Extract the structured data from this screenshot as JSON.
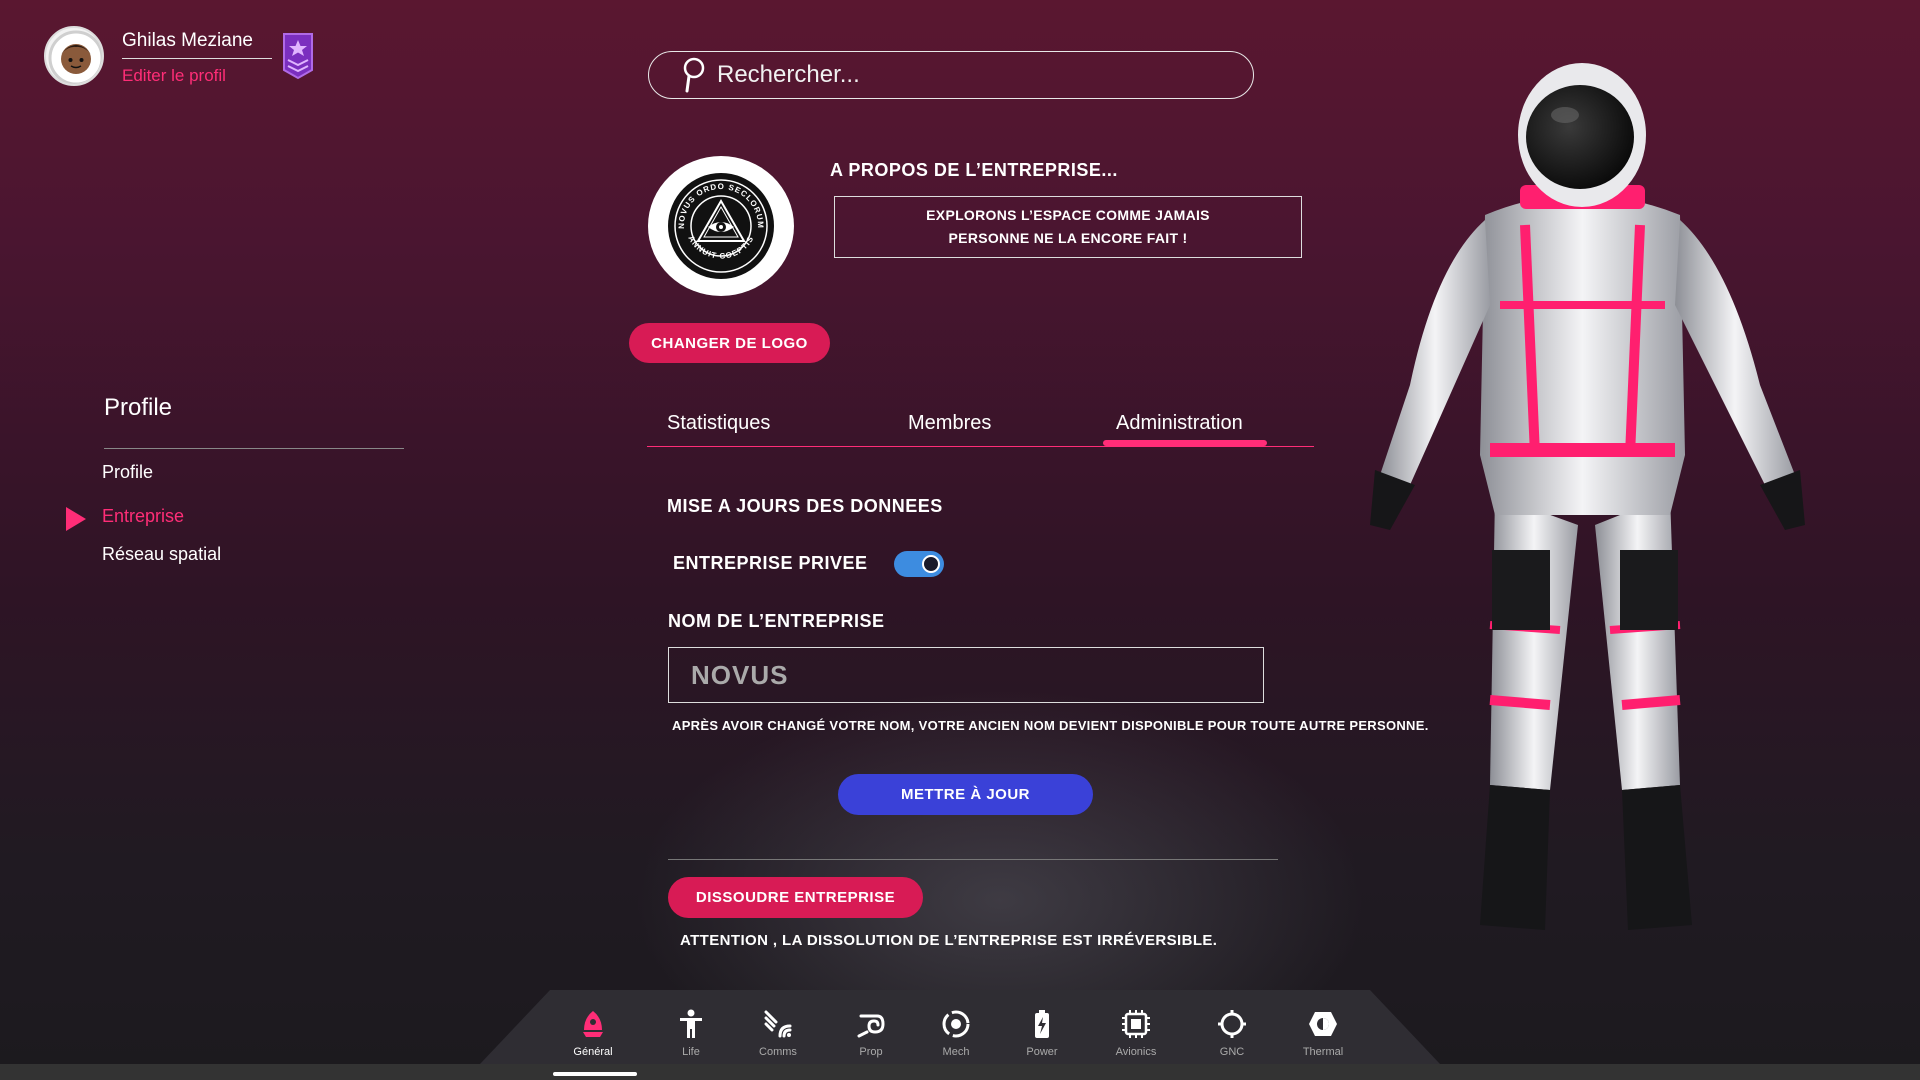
{
  "user": {
    "name": "Ghilas Meziane",
    "edit_profile": "Editer le profil"
  },
  "search": {
    "placeholder": "Rechercher..."
  },
  "company": {
    "about_title": "A PROPOS DE L’ENTREPRISE...",
    "about_text": "EXPLORONS L’ESPACE COMME JAMAIS PERSONNE NE LA ENCORE FAIT !",
    "logo_text_top": "NOVUS ORDO SECLORUM",
    "logo_text_bottom": "ANNUIT COEPTIS",
    "change_logo": "CHANGER DE LOGO"
  },
  "sidebar": {
    "title": "Profile",
    "items": [
      {
        "label": "Profile"
      },
      {
        "label": "Entreprise",
        "active": true
      },
      {
        "label": "Réseau spatial"
      }
    ]
  },
  "tabs": [
    {
      "label": "Statistiques"
    },
    {
      "label": "Membres"
    },
    {
      "label": "Administration",
      "active": true
    }
  ],
  "form": {
    "section_title": "MISE A JOURS DES DONNEES",
    "private_label": "ENTREPRISE PRIVEE",
    "private_enabled": true,
    "name_label": "NOM DE L’ENTREPRISE",
    "name_value": "NOVUS",
    "name_help": "APRÈS AVOIR CHANGÉ VOTRE NOM, VOTRE ANCIEN NOM DEVIENT DISPONIBLE POUR TOUTE AUTRE PERSONNE.",
    "update_button": "METTRE À JOUR",
    "dissolve_button": "DISSOUDRE ENTREPRISE",
    "warning": "ATTENTION , LA DISSOLUTION DE L’ENTREPRISE EST IRRÉVERSIBLE."
  },
  "dock": [
    {
      "label": "Général",
      "icon": "rocket-icon",
      "active": true
    },
    {
      "label": "Life",
      "icon": "person-icon"
    },
    {
      "label": "Comms",
      "icon": "comms-icon"
    },
    {
      "label": "Prop",
      "icon": "propulsion-icon"
    },
    {
      "label": "Mech",
      "icon": "mech-icon"
    },
    {
      "label": "Power",
      "icon": "battery-icon"
    },
    {
      "label": "Avionics",
      "icon": "chip-icon"
    },
    {
      "label": "GNC",
      "icon": "gnc-icon"
    },
    {
      "label": "Thermal",
      "icon": "thermal-icon"
    }
  ],
  "colors": {
    "accent_pink": "#ff2d77",
    "button_pink": "#d81b55",
    "button_blue": "#3a41d8",
    "toggle_blue": "#3d8ce0"
  }
}
